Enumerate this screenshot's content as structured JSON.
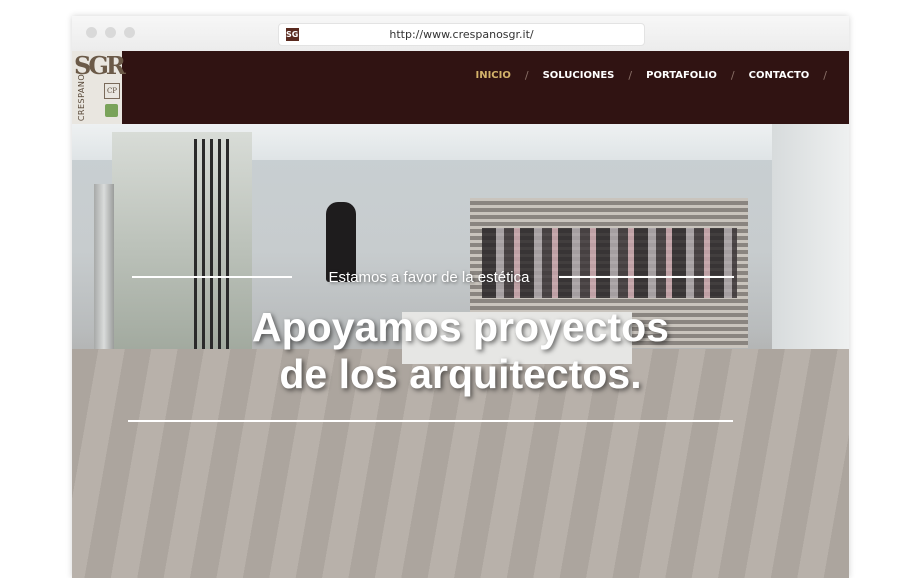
{
  "browser": {
    "url": "http://www.crespanosgr.it/",
    "favicon_text": "SGR"
  },
  "logo": {
    "monogram": "SGR",
    "side_text": "CRESPANO",
    "badge": "CP"
  },
  "nav": {
    "items": [
      {
        "label": "INICIO",
        "active": true
      },
      {
        "label": "SOLUCIONES",
        "active": false
      },
      {
        "label": "PORTAFOLIO",
        "active": false
      },
      {
        "label": "CONTACTO",
        "active": false
      }
    ],
    "separator": "/"
  },
  "hero": {
    "tagline": "Estamos a favor de la estética",
    "headline_line1": "Apoyamos proyectos",
    "headline_line2": "de los arquitectos."
  },
  "colors": {
    "header_bg": "#301312",
    "nav_active": "#d4b36a",
    "nav_text": "#ffffff"
  }
}
